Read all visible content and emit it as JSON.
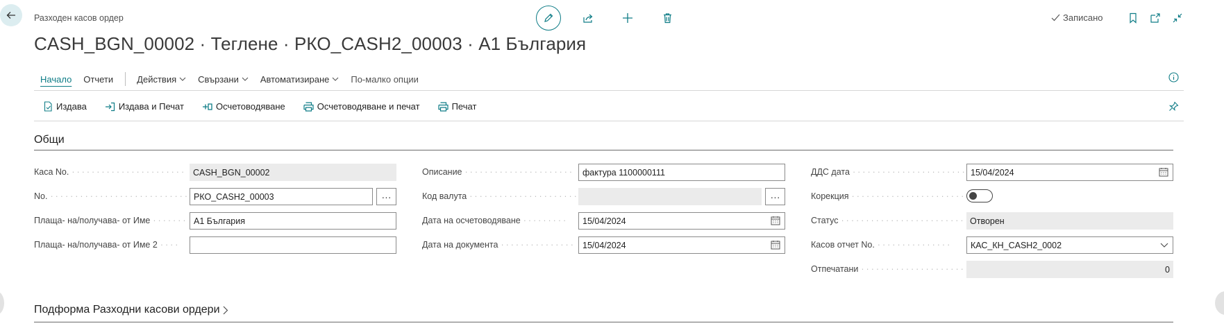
{
  "header": {
    "breadcrumb": "Разходен касов ордер",
    "title": "CASH_BGN_00002 · Теглене · РКО_CASH2_00003 · А1 България",
    "saved_label": "Записано"
  },
  "top_actions": [
    "edit-icon",
    "share-icon",
    "add-icon",
    "delete-icon"
  ],
  "nav": {
    "home": "Начало",
    "reports": "Отчети",
    "actions": "Действия",
    "related": "Свързани",
    "automate": "Автоматизиране",
    "fewer": "По-малко опции"
  },
  "action_bar": {
    "release": "Издава",
    "release_print": "Издава и Печат",
    "post": "Осчетоводяване",
    "post_print": "Осчетоводяване и печат",
    "print": "Печат"
  },
  "general": {
    "heading": "Общи",
    "col1": {
      "cash_no_label": "Каса No.",
      "cash_no_value": "CASH_BGN_00002",
      "no_label": "No.",
      "no_value": "РКО_CASH2_00003",
      "payee_label": "Плаща- на/получава- от Име",
      "payee_value": "А1 България",
      "payee2_label": "Плаща- на/получава- от Име 2",
      "payee2_value": ""
    },
    "col2": {
      "desc_label": "Описание",
      "desc_value": "фактура 1100000111",
      "currency_label": "Код валута",
      "currency_value": "",
      "posting_date_label": "Дата на осчетоводяване",
      "posting_date_value": "15/04/2024",
      "doc_date_label": "Дата на документа",
      "doc_date_value": "15/04/2024"
    },
    "col3": {
      "vat_date_label": "ДДС дата",
      "vat_date_value": "15/04/2024",
      "correction_label": "Корекция",
      "correction_value": false,
      "status_label": "Статус",
      "status_value": "Отворен",
      "report_no_label": "Касов отчет No.",
      "report_no_value": "КАС_КН_CASH2_0002",
      "printed_label": "Отпечатани",
      "printed_value": "0"
    }
  },
  "subform": {
    "heading": "Подформа Разходни касови ордери"
  },
  "colors": {
    "accent": "#0e7c86"
  }
}
